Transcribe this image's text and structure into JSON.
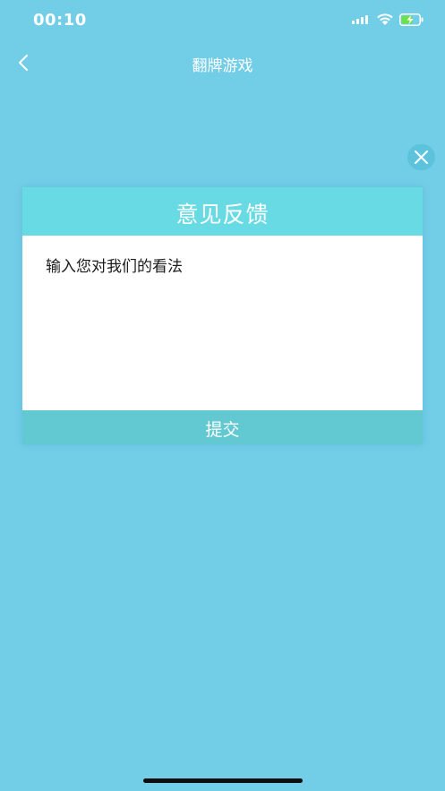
{
  "status_bar": {
    "time": "00:10",
    "signal_icon": "cellular-signal-icon",
    "wifi_icon": "wifi-icon",
    "battery_icon": "battery-charging-icon",
    "battery_color": "#6ee04a"
  },
  "nav": {
    "back_icon": "chevron-left-icon",
    "title": "翻牌游戏"
  },
  "dialog": {
    "close_icon": "close-icon",
    "title": "意见反馈",
    "input_placeholder": "输入您对我们的看法",
    "input_value": "",
    "submit_label": "提交"
  },
  "colors": {
    "background": "#72cde6",
    "dialog_header": "#67dae4",
    "submit_button": "#62c9d2",
    "close_button": "#5dc3dd"
  }
}
